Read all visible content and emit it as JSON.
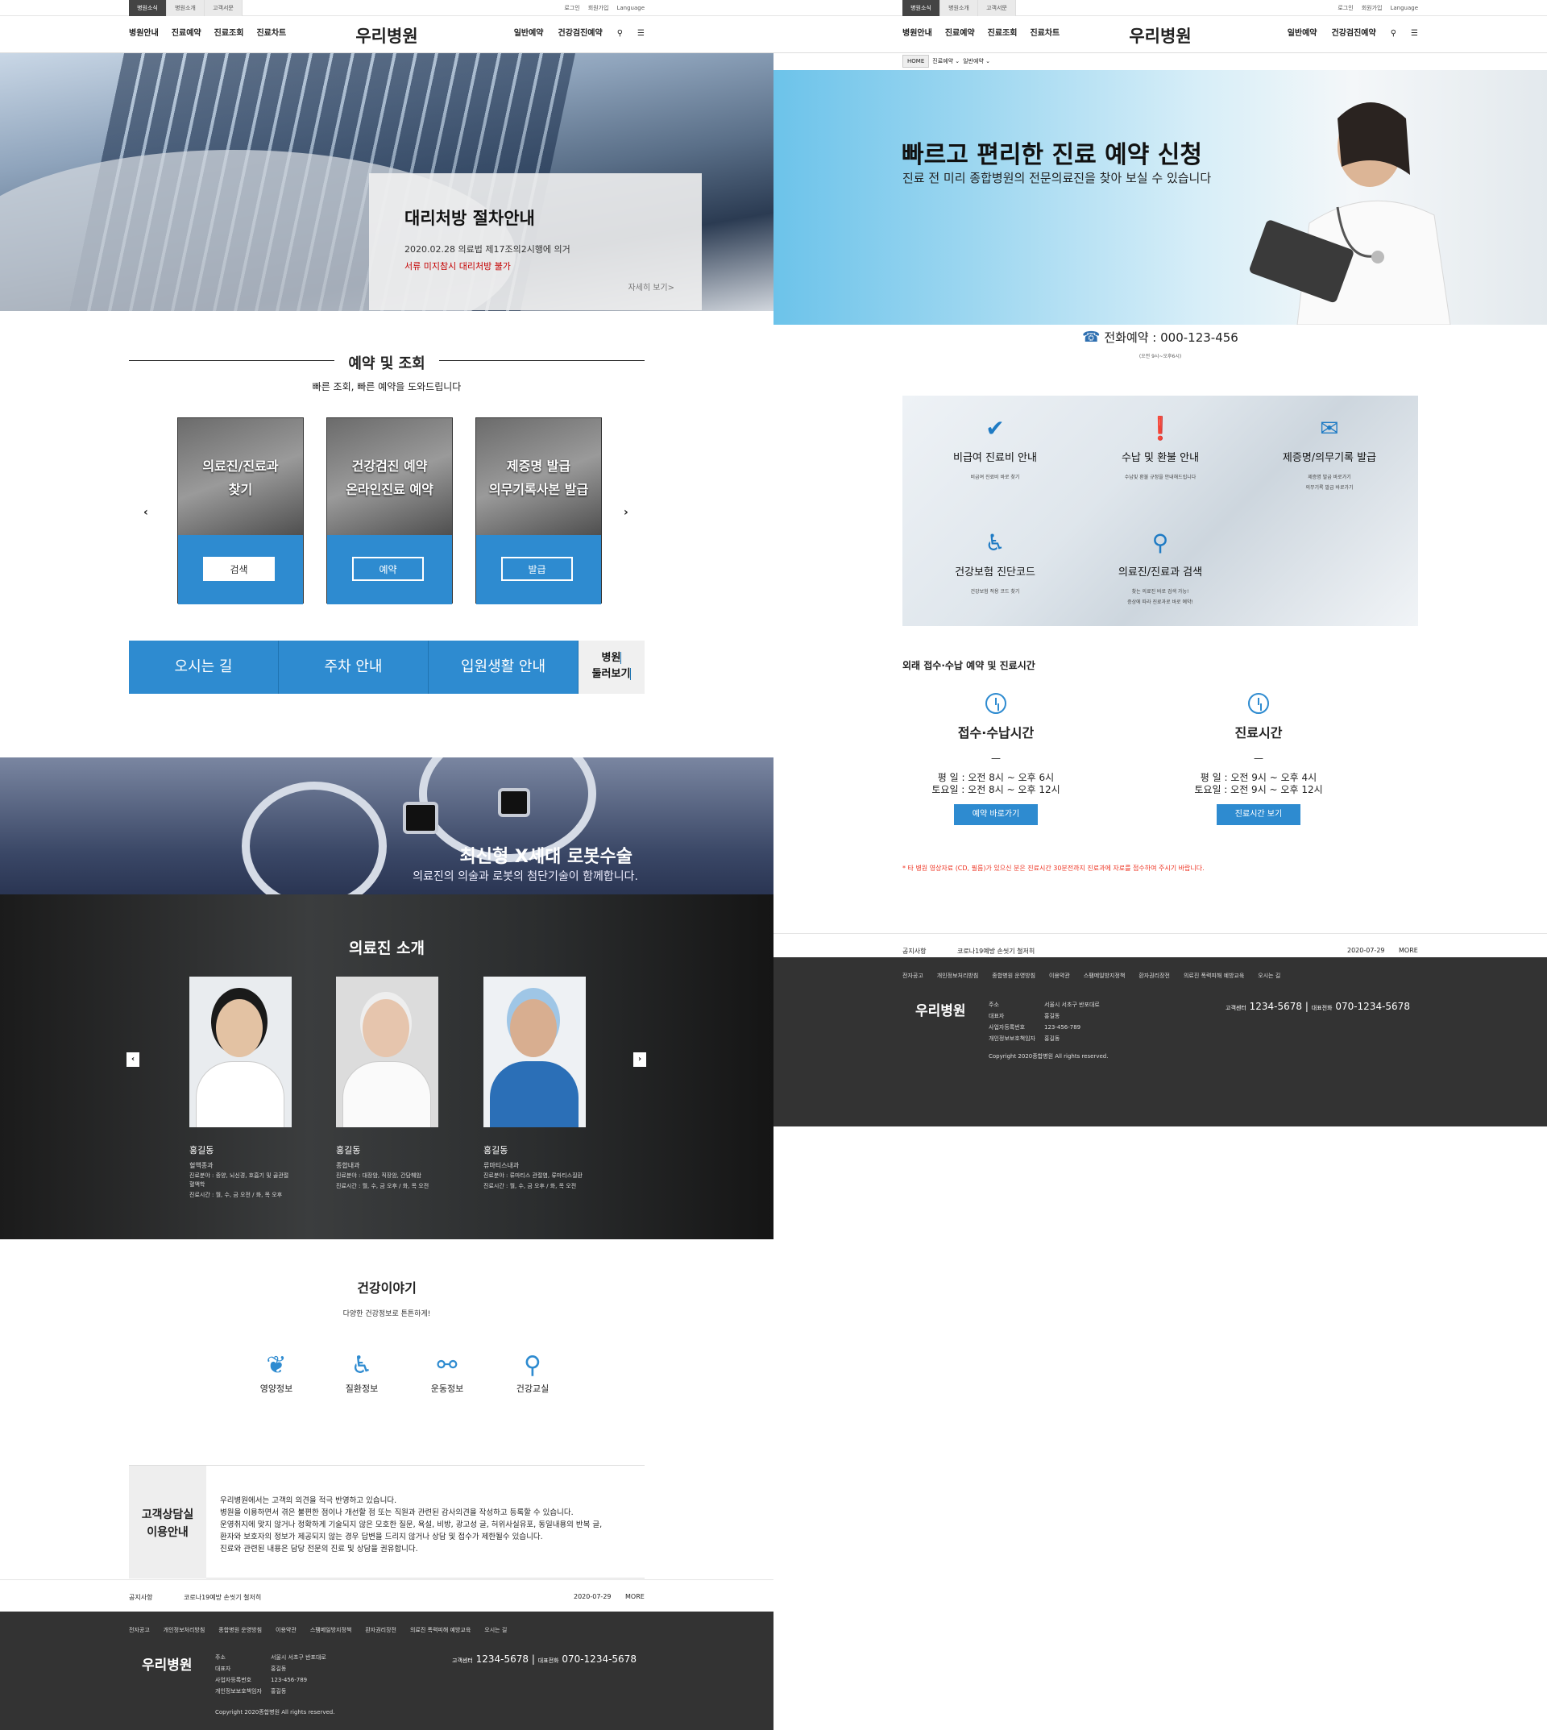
{
  "left": {
    "util": {
      "tabs": [
        "병원소식",
        "병원소개",
        "고객서문"
      ],
      "links": [
        "로그인",
        "회원가입",
        "Language"
      ]
    },
    "gnb": {
      "menu_left": [
        "병원안내",
        "진료예약",
        "진료조회",
        "진료차트"
      ],
      "logo": "우리병원",
      "menu_right": [
        "일반예약",
        "건강검진예약"
      ]
    },
    "hero": {
      "title": "대리처방 절차안내",
      "line1": "2020.02.28 의료법 제17조의2시행에 의거",
      "line2": "서류 미지참시 대리처방 불가",
      "more": "자세히 보기>"
    },
    "reserve": {
      "title": "예약 및 조회",
      "subtitle": "빠른 조회, 빠른 예약을 도와드립니다",
      "cards": [
        {
          "l1": "의료진/진료과",
          "l2": "찾기",
          "btn": "검색"
        },
        {
          "l1": "건강검진 예약",
          "l2": "온라인진료 예약",
          "btn": "예약"
        },
        {
          "l1": "제증명 발급",
          "l2": "의무기록사본 발급",
          "btn": "발급"
        }
      ],
      "prev": "‹",
      "next": "›"
    },
    "quick": [
      "오시는 길",
      "주차 안내",
      "입원생활 안내"
    ],
    "quick_last": {
      "l1": "병원",
      "l2": "둘러보기"
    },
    "robot": {
      "title": "최신형 X세대 로봇수술",
      "desc": "의료진의 의술과 로봇의 첨단기술이 함께합니다."
    },
    "doctors": {
      "title": "의료진 소개",
      "prev": "‹",
      "next": "›",
      "list": [
        {
          "name": "홍길동",
          "dept": "혈액종과",
          "info1": "진료분야 : 종양, 뇌신경, 호흡기 및 골관절 혈액학",
          "info2": "진료시간 : 월, 수, 금 오전 / 화, 목 오후"
        },
        {
          "name": "홍길동",
          "dept": "종합내과",
          "info1": "진료분야 : 대장암, 직장암, 간담췌암",
          "info2": "진료시간 : 월, 수, 금 오후 / 화, 목 오전"
        },
        {
          "name": "홍길동",
          "dept": "류마티스내과",
          "info1": "진료분야 : 류마티스 관절염, 류마티스질환",
          "info2": "진료시간 : 월, 수, 금 오후 / 화, 목 오전"
        }
      ]
    },
    "story": {
      "title": "건강이야기",
      "subtitle": "다양한 건강정보로 튼튼하게!",
      "items": [
        "영양정보",
        "질환정보",
        "운동정보",
        "건강교실"
      ]
    },
    "consult": {
      "label1": "고객상담실",
      "label2": "이용안내",
      "text": "우리병원에서는 고객의 의견을 적극 반영하고 있습니다.\n병원을 이용하면서 겪은 불편한 점이나 개선할 점 또는 직원과 관련된 감사의견을 작성하고 등록할 수 있습니다.\n운영취지에 맞지 않거나 정확하게 기술되지 않은 모호한 질문, 욕설, 비방, 광고성 글, 허위사실유포, 동일내용의 반복 글,\n환자와 보호자의 정보가 제공되지 않는 경우 답변을 드리지 않거나 상담 및 접수가 제한될수 있습니다.\n진료와 관련된 내용은 담당 전문의 진료 및 상담을 권유합니다."
    },
    "notice": {
      "label": "공지사항",
      "title": "코로나19예방 손씻기 철저히",
      "date": "2020-07-29",
      "more": "MORE"
    }
  },
  "footer": {
    "links": [
      "전자공고",
      "개인정보처리방침",
      "종합병원 운영방침",
      "이용약관",
      "스팸메일방지정책",
      "환자권리장전",
      "의료진 폭력피해 예방교육",
      "오시는 길"
    ],
    "logo": "우리병원",
    "k1": "주소",
    "k2": "대표자",
    "k3": "사업자등록번호",
    "k4": "개인정보보호책임자",
    "v1": "서울시 서초구 반포대로",
    "v2": "홍길동",
    "v3": "123-456-789",
    "v4": "홍길동",
    "tel_label": "고객센터",
    "tel": "1234-5678",
    "sep": "|",
    "rep_label": "대표전화",
    "rep": "070-1234-5678",
    "copyright": "Copyright 2020종합병원 All rights reserved."
  },
  "right": {
    "util": {
      "tabs": [
        "병원소식",
        "병원소개",
        "고객서문"
      ],
      "links": [
        "로그인",
        "회원가입",
        "Language"
      ]
    },
    "gnb": {
      "menu_left": [
        "병원안내",
        "진료예약",
        "진료조회",
        "진료차트"
      ],
      "logo": "우리병원",
      "menu_right": [
        "일반예약",
        "건강검진예약"
      ]
    },
    "breadcrumb": [
      "HOME",
      "진료예약 ⌄",
      "일반예약 ⌄"
    ],
    "hero": {
      "title": "빠르고 편리한 진료 예약 신청",
      "desc": "진료 전 미리 종합병원의 전문의료진을 찾아 보실 수 있습니다"
    },
    "phone": {
      "label": "전화예약 : 000-123-456",
      "hours": "(오전 9시~오후6시)"
    },
    "services": [
      {
        "t": "비급여 진료비 안내",
        "d1": "비급여 진료비 바로 찾기",
        "d2": ""
      },
      {
        "t": "수납 및 환불 안내",
        "d1": "수납및 환불 규정을 안내해드립니다",
        "d2": ""
      },
      {
        "t": "제증명/의무기록 발급",
        "d1": "제증명 발급 바로가기",
        "d2": "의무기록 발급 바로가기"
      },
      {
        "t": "건강보험 진단코드",
        "d1": "건강보험 적용 코드 찾기",
        "d2": ""
      },
      {
        "t": "의료진/진료과 검색",
        "d1": "찾는 의료진 바로 검색 가능!",
        "d2": "증상에 따라 진료과로 바로 예약!"
      }
    ],
    "hours_title": "외래 접수·수납 예약 및 진료시간",
    "hours": [
      {
        "title": "접수·수납시간",
        "dash": "—",
        "l1": "평 일 : 오전 8시 ~ 오후 6시",
        "l2": "토요일 : 오전 8시 ~ 오후 12시",
        "btn": "예약 바로가기"
      },
      {
        "title": "진료시간",
        "dash": "—",
        "l1": "평 일 : 오전 9시 ~ 오후 4시",
        "l2": "토요일 : 오전 9시 ~ 오후 12시",
        "btn": "진료시간 보기"
      }
    ],
    "warning": "* 타 병원 영상자료 (CD, 필름)가 있으신 분은 진료시간 30분전까지 진료과에 자료를 접수하여 주시기 바랍니다.",
    "notice": {
      "label": "공지사항",
      "title": "코로나19예방 손씻기 철저히",
      "date": "2020-07-29",
      "more": "MORE"
    }
  },
  "colors": {
    "accent": "#2e8bd0",
    "footer": "#333333",
    "warning": "#ee3322"
  }
}
